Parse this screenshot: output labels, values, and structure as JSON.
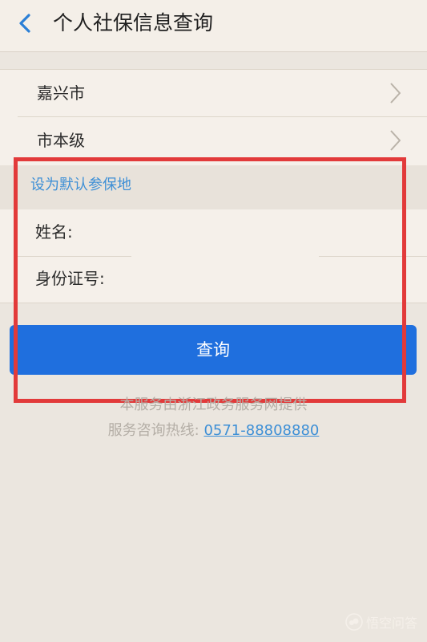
{
  "header": {
    "title": "个人社保信息查询"
  },
  "selection": {
    "city": "嘉兴市",
    "district": "市本级"
  },
  "default_link": "设为默认参保地",
  "form": {
    "name_label": "姓名:",
    "name_value": "",
    "id_label": "身份证号:",
    "id_value": ""
  },
  "query_button_label": "查询",
  "footer": {
    "provider_note": "本服务由浙江政务服务网提供",
    "hotline_label": "服务咨询热线:",
    "hotline_number": "0571-88808880"
  },
  "watermark": {
    "text": "悟空问答"
  },
  "colors": {
    "accent_blue": "#1f6fde",
    "link_blue": "#3d8fd6",
    "highlight_red": "#e23a3a",
    "background": "#ebe6df",
    "card": "#f5f0ea"
  },
  "icons": {
    "back": "chevron-left-icon",
    "row_arrow": "chevron-right-icon",
    "watermark_logo": "cloud-logo-icon"
  }
}
